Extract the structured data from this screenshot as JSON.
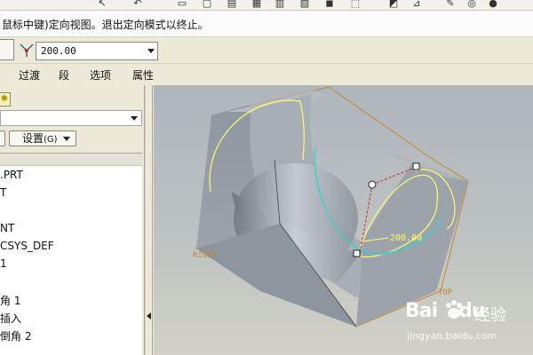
{
  "message": {
    "text": "鼠标中键)定向视图。退出定向模式以终止。"
  },
  "dashboard": {
    "value": "200.00"
  },
  "panel_tabs": [
    "过渡",
    "段",
    "选项",
    "属性"
  ],
  "model_tree": {
    "settings_label": "设置",
    "settings_shortcut": "(G)",
    "items": [
      ".PRT",
      "T",
      "NT",
      "CSYS_DEF",
      "1",
      "角 1",
      "插入",
      "倒角 2"
    ]
  },
  "viewport": {
    "dimension_value": "200.00",
    "datum_right": "RIGHT",
    "datum_top": "TOP"
  },
  "watermark": {
    "brand": "Bai",
    "brand_suffix": "du",
    "product": "经验",
    "url": "jingyan.baidu.com"
  },
  "colors": {
    "part_edges": "#c8852e",
    "cyan_curve": "#2fd3d0",
    "yellow_curve": "#ffff66",
    "dim_label": "#ffff66"
  }
}
